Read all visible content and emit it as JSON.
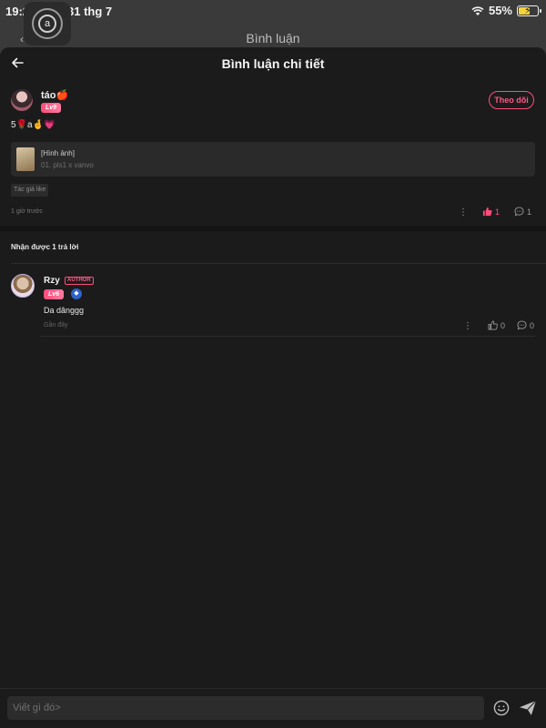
{
  "status_bar": {
    "time": "19:2",
    "date": "31 thg 7",
    "battery": "55%"
  },
  "behind": {
    "title": "Bình luận"
  },
  "header": {
    "title": "Bình luận chi tiết"
  },
  "comment": {
    "username": "táo🍎",
    "level": "Lv9",
    "follow_label": "Theo dõi",
    "text": "5🌹a🤞💗",
    "attachment_title": "[Hình ảnh]",
    "attachment_subtitle": "01. pls1 x vanvo",
    "author_liked": "Tác giả like",
    "time": "1 giờ trước",
    "likes": "1",
    "replies": "1"
  },
  "replies": {
    "header": "Nhận được 1 trả lời",
    "items": [
      {
        "username": "Rzy",
        "author_badge": "AUTHOR",
        "level": "Lv6",
        "text": "Da dânggg",
        "time": "Gần đây",
        "likes": "0",
        "replies": "0"
      }
    ]
  },
  "composer": {
    "placeholder": "Viết gì đó>"
  },
  "colors": {
    "accent": "#ff4d7a",
    "background": "#1b1b1c"
  }
}
